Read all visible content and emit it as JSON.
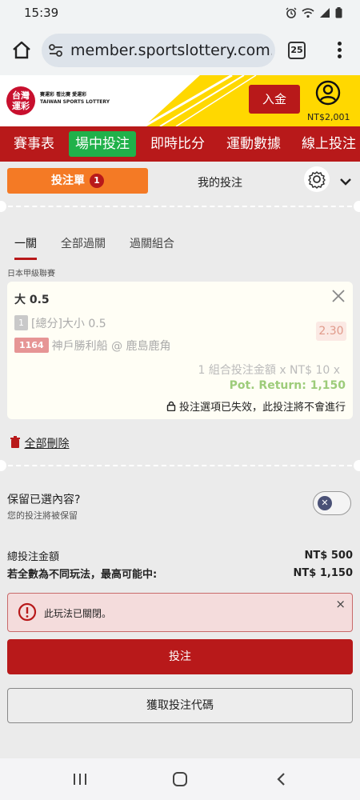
{
  "status_bar": {
    "time": "15:39",
    "battery_icon": "battery-icon",
    "wifi_icon": "wifi-icon",
    "signal_icon": "signal-icon",
    "alarm_icon": "alarm-icon"
  },
  "browser": {
    "url": "member.sportslottery.com.tw",
    "tab_count": "25"
  },
  "header": {
    "logo_top": "台灣",
    "logo_bottom": "運彩",
    "logo_line1": "賽運彩  看比賽  愛運彩",
    "logo_line2": "TAIWAN SPORTS LOTTERY",
    "deposit_label": "入金",
    "balance": "NT$2,001"
  },
  "nav": {
    "items": [
      {
        "label": "賽事表"
      },
      {
        "label": "場中投注"
      },
      {
        "label": "即時比分"
      },
      {
        "label": "運動數據"
      },
      {
        "label": "線上投注"
      }
    ],
    "active_index": 1
  },
  "bet_tabs": {
    "betslip_label": "投注單",
    "betslip_count": "1",
    "mybets_label": "我的投注"
  },
  "type_tabs": [
    "一關",
    "全部過關",
    "過關組合"
  ],
  "league": "日本甲級聯賽",
  "bet": {
    "title": "大 0.5",
    "selection_num": "1",
    "selection_text": "[總分]大小 0.5",
    "event_id": "1164",
    "event_name": "神戶勝利船 @ 鹿島鹿角",
    "odds": "2.30",
    "combo_text": "1 組合投注金額 x NT$ 10 x",
    "pot_return": "Pot. Return: 1,150",
    "invalid_text": "投注選項已失效，此投注將不會進行"
  },
  "delete_all_label": "全部刪除",
  "keep": {
    "title": "保留已選內容?",
    "subtitle": "您的投注將被保留"
  },
  "totals": {
    "total_label": "總投注金額",
    "total_value": "NT$ 500",
    "max_label": "若全數為不同玩法，最高可能中:",
    "max_value": "NT$ 1,150"
  },
  "alert": {
    "text": "此玩法已關閉。",
    "close": "×"
  },
  "buttons": {
    "place_bet": "投注",
    "get_code": "獲取投注代碼"
  },
  "colors": {
    "brand_red": "#b8191a",
    "active_green": "#20b14a",
    "orange": "#f47a25",
    "header_yellow": "#ffd800"
  }
}
